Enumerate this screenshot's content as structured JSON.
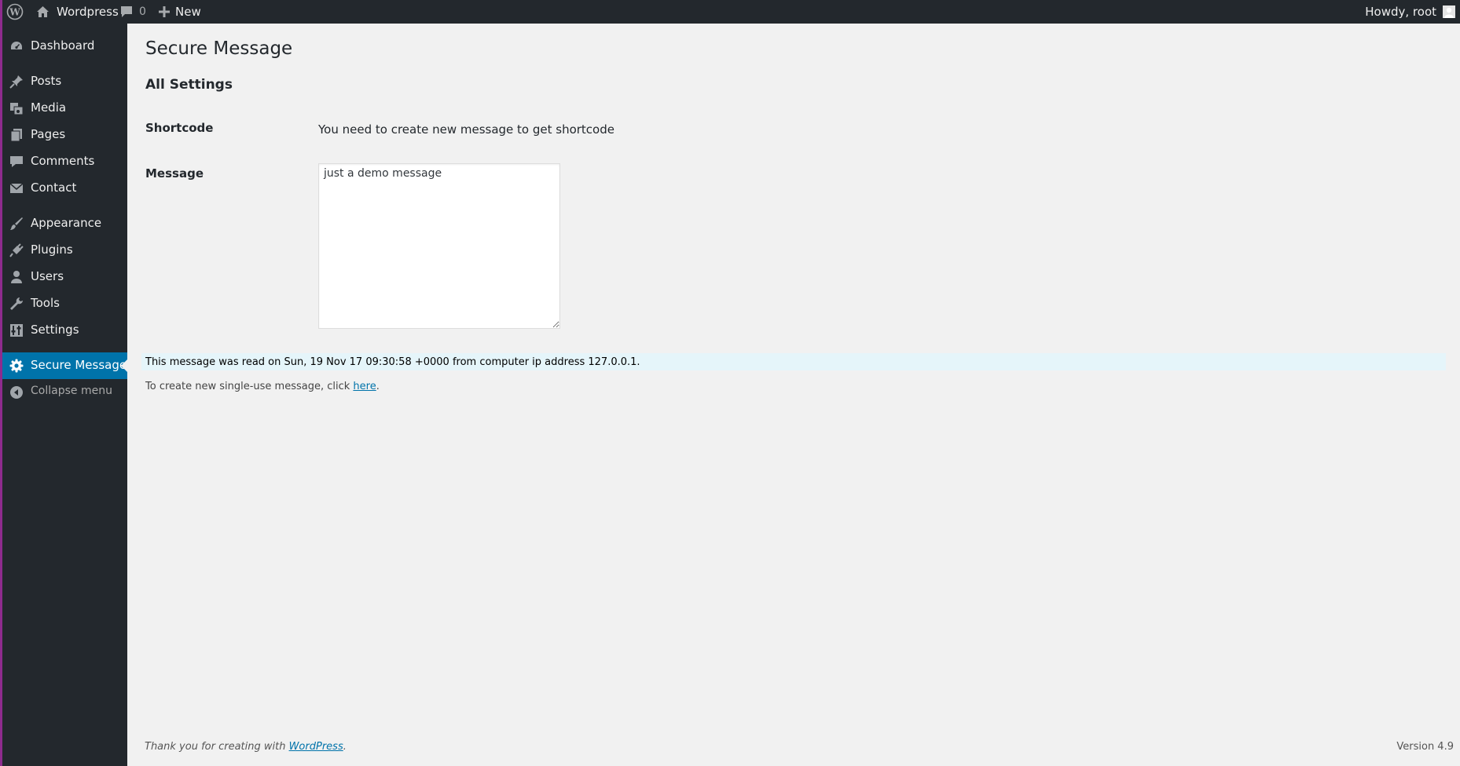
{
  "adminbar": {
    "site_name": "Wordpress",
    "comments_count": "0",
    "new_label": "New",
    "howdy": "Howdy, root"
  },
  "sidebar": {
    "items": [
      {
        "label": "Dashboard",
        "icon": "dashboard-icon"
      },
      {
        "label": "Posts",
        "icon": "pin-icon"
      },
      {
        "label": "Media",
        "icon": "media-icon"
      },
      {
        "label": "Pages",
        "icon": "pages-icon"
      },
      {
        "label": "Comments",
        "icon": "comment-icon"
      },
      {
        "label": "Contact",
        "icon": "mail-icon"
      },
      {
        "label": "Appearance",
        "icon": "brush-icon"
      },
      {
        "label": "Plugins",
        "icon": "plug-icon"
      },
      {
        "label": "Users",
        "icon": "user-icon"
      },
      {
        "label": "Tools",
        "icon": "wrench-icon"
      },
      {
        "label": "Settings",
        "icon": "sliders-icon"
      },
      {
        "label": "Secure Message",
        "icon": "gear-icon"
      }
    ],
    "collapse_label": "Collapse menu"
  },
  "page": {
    "title": "Secure Message",
    "section": "All Settings",
    "shortcode_label": "Shortcode",
    "shortcode_value": "You need to create new message to get shortcode",
    "message_label": "Message",
    "message_value": "just a demo message",
    "notice": "This message was read on Sun, 19 Nov 17 09:30:58 +0000 from computer ip address 127.0.0.1.",
    "hint_prefix": "To create new single-use message, click ",
    "hint_link": "here",
    "hint_suffix": "."
  },
  "footer": {
    "thanks_prefix": "Thank you for creating with ",
    "thanks_link": "WordPress",
    "thanks_suffix": ".",
    "version": "Version 4.9"
  },
  "colors": {
    "adminbar_bg": "#23282d",
    "sidebar_bg": "#23282d",
    "accent": "#0073aa",
    "content_bg": "#f1f1f1",
    "notice_bg": "#e5f5fa"
  }
}
